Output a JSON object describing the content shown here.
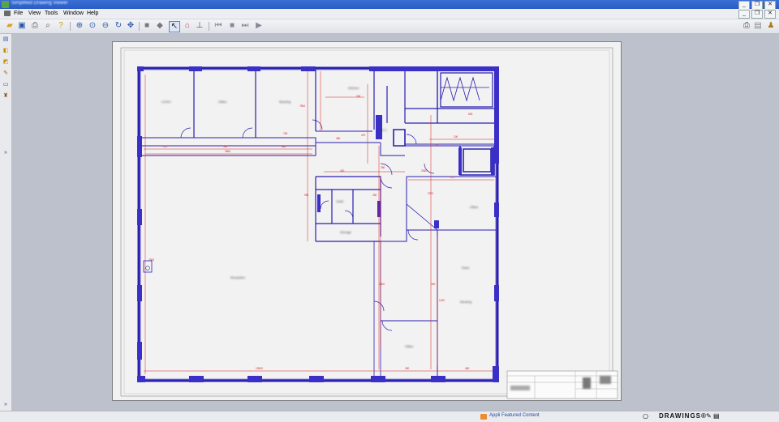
{
  "window": {
    "title": "Simplified Drawing Viewer",
    "minimize": "_",
    "restore": "❐",
    "close": "✕"
  },
  "menu": [
    "File",
    "View",
    "Tools",
    "Window",
    "Help"
  ],
  "toolbar": {
    "icons": [
      "open-icon",
      "save-icon",
      "print-icon",
      "print-preview-icon",
      "help-icon",
      "zoom-in-icon",
      "zoom-window-icon",
      "zoom-out-icon",
      "refresh-icon",
      "pan-icon",
      "layer-icon",
      "shade-icon",
      "select-icon",
      "home-view-icon",
      "scale-icon",
      "first-page-icon",
      "stop-icon",
      "next-page-icon",
      "play-icon"
    ]
  },
  "statusbar": {
    "feed_text": "Appli Featured Content",
    "brand": "DRAWINGS®"
  },
  "drawing": {
    "room_labels": [
      "LOGO",
      "Office",
      "Meeting",
      "Kitchen",
      "W C",
      "Office",
      "Toilet",
      "Storage",
      "Reception",
      "Meeting",
      "Office",
      "Plant"
    ],
    "dims": [
      "470",
      "580",
      "680",
      "3560",
      "760",
      "480",
      "7500",
      "260",
      "430",
      "280",
      "2360",
      "950",
      "170",
      "2370",
      "250",
      "2300",
      "250",
      "1320",
      "100",
      "600",
      "13500",
      "250",
      "450",
      "470",
      "7500",
      "250"
    ]
  },
  "colors": {
    "walls": "#2a1fb0",
    "dims": "#d81e1e",
    "paper": "#f2f2f2",
    "title": "#2a5ec4"
  }
}
